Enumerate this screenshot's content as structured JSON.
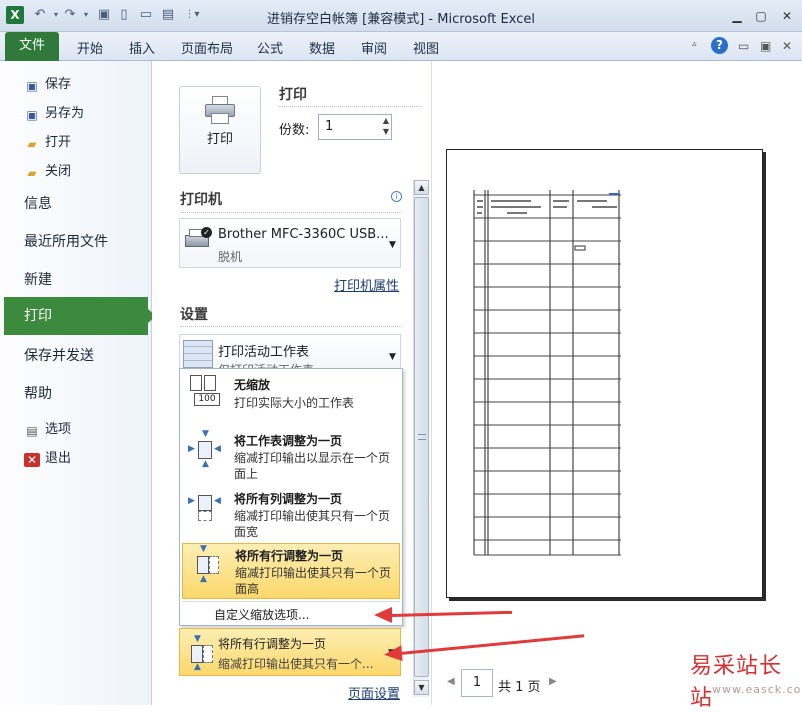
{
  "window": {
    "title": "进销存空白帐簿 [兼容模式] - Microsoft Excel",
    "app_icon": "X"
  },
  "ribbon": {
    "file_tab": "文件",
    "tabs": [
      "开始",
      "插入",
      "页面布局",
      "公式",
      "数据",
      "审阅",
      "视图"
    ]
  },
  "nav": {
    "save": "保存",
    "save_as": "另存为",
    "open": "打开",
    "close": "关闭",
    "info": "信息",
    "recent": "最近所用文件",
    "new": "新建",
    "print": "打印",
    "save_send": "保存并发送",
    "help": "帮助",
    "options": "选项",
    "exit": "退出"
  },
  "print_panel": {
    "print_button": "打印",
    "print_heading": "打印",
    "copies_label": "份数:",
    "copies_value": "1",
    "printer_heading": "打印机",
    "printer_name": "Brother MFC-3360C USB...",
    "printer_status": "脱机",
    "printer_properties": "打印机属性",
    "settings_heading": "设置",
    "active_sheet_title": "打印活动工作表",
    "active_sheet_desc": "仅打印活动工作表",
    "page_setup": "页面设置"
  },
  "scale_menu": {
    "items": [
      {
        "title": "无缩放",
        "desc": "打印实际大小的工作表",
        "icon_text": "100"
      },
      {
        "title": "将工作表调整为一页",
        "desc": "缩减打印输出以显示在一个页面上"
      },
      {
        "title": "将所有列调整为一页",
        "desc": "缩减打印输出使其只有一个页面宽"
      },
      {
        "title": "将所有行调整为一页",
        "desc": "缩减打印输出使其只有一个页面高"
      }
    ],
    "custom_option": "自定义缩放选项...",
    "selected_title": "将所有行调整为一页",
    "selected_desc": "缩减打印输出使其只有一个..."
  },
  "preview": {
    "page_number": "1",
    "total_pages": "共 1 页"
  },
  "watermark": {
    "name": "易采站长站",
    "url": "www.easck.com"
  },
  "colors": {
    "file_tab": "#2f7a3b",
    "print_nav_selected": "#3b8a3e",
    "menu_highlight": "#fbd86b",
    "annotation_arrow": "#e03a3a"
  }
}
